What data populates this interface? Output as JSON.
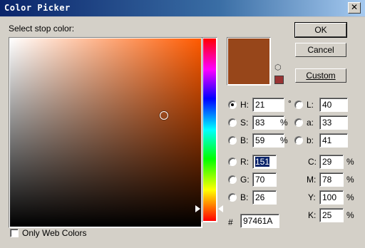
{
  "window": {
    "title": "Color Picker",
    "close_glyph": "✕"
  },
  "header": {
    "prompt": "Select stop color:"
  },
  "buttons": {
    "ok": "OK",
    "cancel": "Cancel",
    "custom": "Custom"
  },
  "colors": {
    "current": "#97461a",
    "field_hue": "#ff5a00"
  },
  "hsb": {
    "h": {
      "label": "H:",
      "value": "21",
      "unit": "°"
    },
    "s": {
      "label": "S:",
      "value": "83",
      "unit": "%"
    },
    "b": {
      "label": "B:",
      "value": "59",
      "unit": "%"
    }
  },
  "lab": {
    "l": {
      "label": "L:",
      "value": "40"
    },
    "a": {
      "label": "a:",
      "value": "33"
    },
    "b": {
      "label": "b:",
      "value": "41"
    }
  },
  "rgb": {
    "r": {
      "label": "R:",
      "value": "151"
    },
    "g": {
      "label": "G:",
      "value": "70"
    },
    "b": {
      "label": "B:",
      "value": "26"
    }
  },
  "cmyk": {
    "c": {
      "label": "C:",
      "value": "29",
      "unit": "%"
    },
    "m": {
      "label": "M:",
      "value": "78",
      "unit": "%"
    },
    "y": {
      "label": "Y:",
      "value": "100",
      "unit": "%"
    },
    "k": {
      "label": "K:",
      "value": "25",
      "unit": "%"
    }
  },
  "hex": {
    "label": "#",
    "value": "97461A"
  },
  "only_web_colors": {
    "label": "Only Web Colors",
    "checked": false
  },
  "icons": {
    "gamut": "cube-icon"
  }
}
